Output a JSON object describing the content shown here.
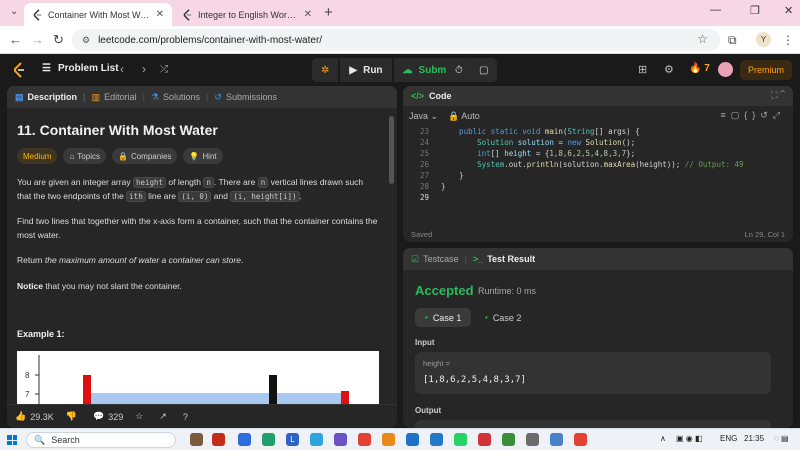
{
  "browser": {
    "tabs": [
      {
        "title": "Container With Most Water - Le",
        "active": true
      },
      {
        "title": "Integer to English Words - Leet",
        "active": false
      }
    ],
    "url": "leetcode.com/problems/container-with-most-water/",
    "profile_initial": "Y"
  },
  "nav": {
    "problem_list": "Problem List",
    "run": "Run",
    "submit": "Submit",
    "streak": "7",
    "premium": "Premium"
  },
  "left_panel": {
    "tabs": [
      "Description",
      "Editorial",
      "Solutions",
      "Submissions"
    ],
    "title": "11. Container With Most Water",
    "chips": [
      "Medium",
      "Topics",
      "Companies",
      "Hint"
    ],
    "p1": {
      "a": "You are given an integer array ",
      "code1": "height",
      "b": " of length ",
      "code2": "n",
      "c": ". There are ",
      "code3": "n",
      "d": " vertical lines drawn such that the two endpoints of the ",
      "code4": "ith",
      "e": " line are ",
      "code5": "(i, 0)",
      "f": " and ",
      "code6": "(i, height[i])",
      "g": "."
    },
    "p2": "Find two lines that together with the x-axis form a container, such that the container contains the most water.",
    "p3": {
      "a": "Return ",
      "em": "the maximum amount of water a container can store",
      "b": "."
    },
    "p4": {
      "bold": "Notice",
      "rest": " that you may not slant the container."
    },
    "example_title": "Example 1:",
    "figure_ticks": [
      "8",
      "7",
      "6"
    ],
    "footer": {
      "likes": "29.3K",
      "comments": "329"
    }
  },
  "code_panel": {
    "title": "Code",
    "language": "Java",
    "mode": "Auto",
    "lines": [
      {
        "n": "23",
        "t": "    public static void main(String[] args) {"
      },
      {
        "n": "24",
        "t": "        Solution solution = new Solution();"
      },
      {
        "n": "25",
        "t": "        int[] height = {1,8,6,2,5,4,8,3,7};"
      },
      {
        "n": "26",
        "t": "        System.out.println(solution.maxArea(height)); // Output: 49"
      },
      {
        "n": "27",
        "t": "    }"
      },
      {
        "n": "28",
        "t": "}"
      },
      {
        "n": "29",
        "t": ""
      }
    ],
    "status_left": "Saved",
    "status_right": "Ln 29, Col 1"
  },
  "test_panel": {
    "tabs": [
      "Testcase",
      "Test Result"
    ],
    "verdict": "Accepted",
    "runtime": "Runtime: 0 ms",
    "cases": [
      "Case 1",
      "Case 2"
    ],
    "input_label": "Input",
    "input_key": "height =",
    "input_value": "[1,8,6,2,5,4,8,3,7]",
    "output_label": "Output"
  },
  "taskbar": {
    "search": "Search",
    "lang": "ENG",
    "time": "21:35"
  },
  "colors": {
    "accent_green": "#2cbb5d",
    "accent_orange": "#ffa116",
    "medium": "#ffb800"
  }
}
